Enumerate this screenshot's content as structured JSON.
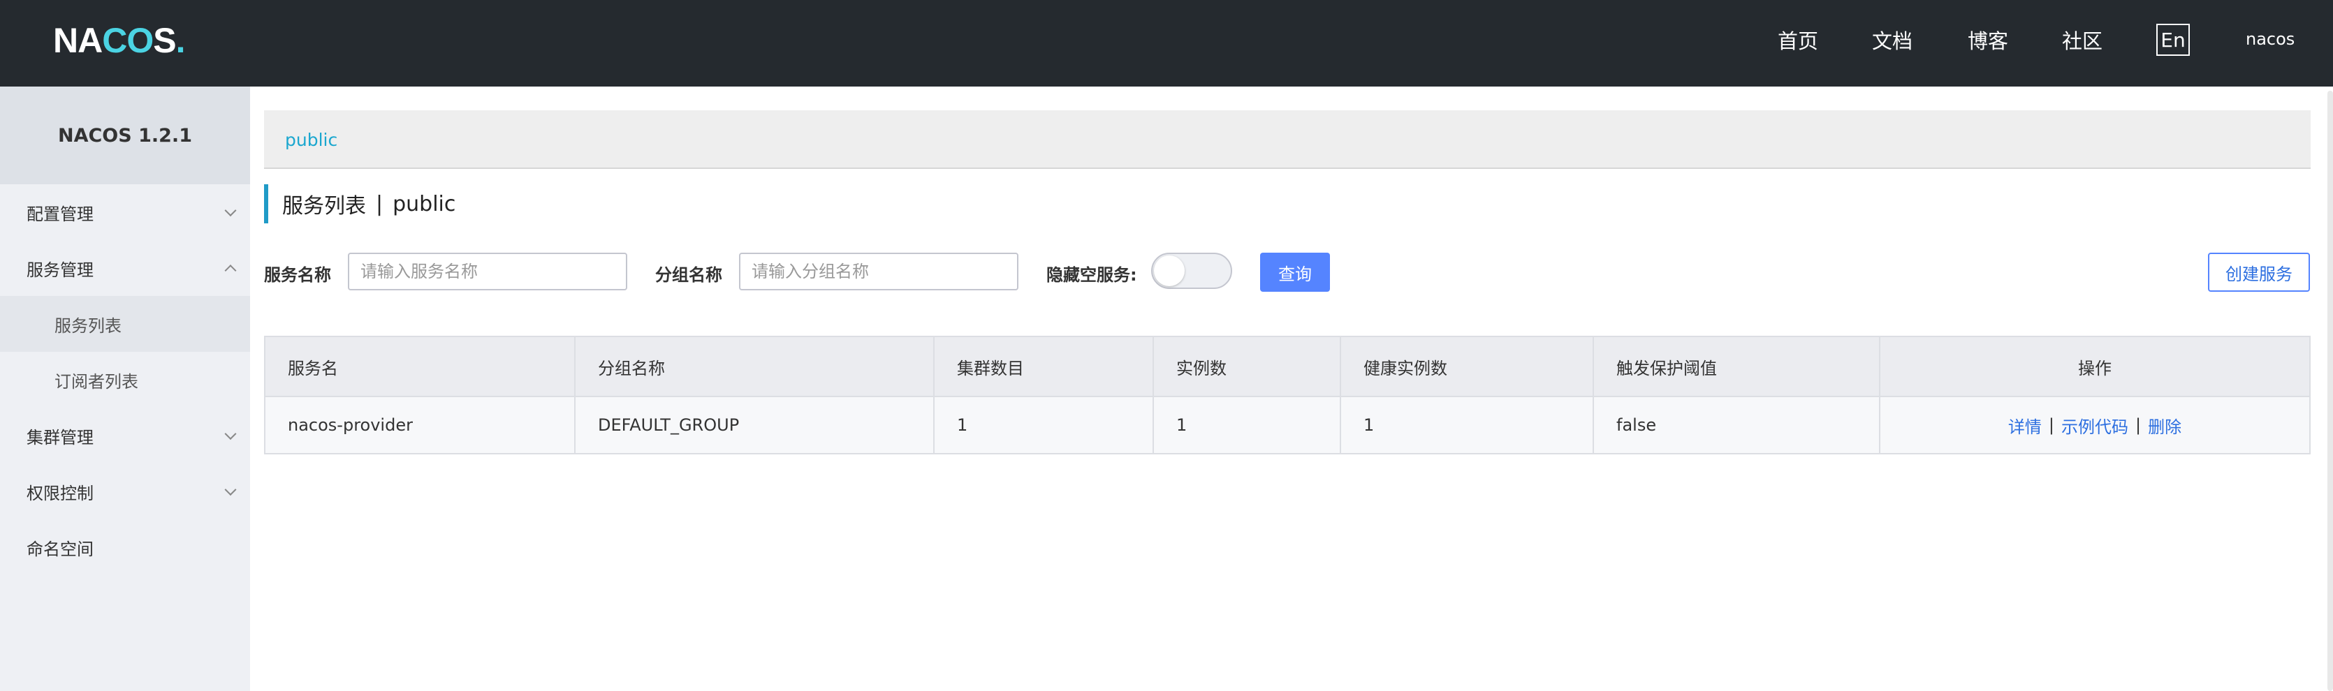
{
  "header": {
    "logo": "NACOS.",
    "nav": [
      "首页",
      "文档",
      "博客",
      "社区"
    ],
    "lang_button": "En",
    "user": "nacos"
  },
  "sidebar": {
    "title": "NACOS 1.2.1",
    "items": [
      {
        "label": "配置管理",
        "expanded": false
      },
      {
        "label": "服务管理",
        "expanded": true
      },
      {
        "label": "服务列表",
        "sub": true,
        "active": true
      },
      {
        "label": "订阅者列表",
        "sub": true
      },
      {
        "label": "集群管理",
        "expanded": false
      },
      {
        "label": "权限控制",
        "expanded": false
      },
      {
        "label": "命名空间"
      }
    ]
  },
  "main": {
    "breadcrumb": "public",
    "page_title": "服务列表",
    "page_title_sep": "|",
    "page_title_namespace": "public",
    "filters": {
      "service_name_label": "服务名称",
      "service_name_placeholder": "请输入服务名称",
      "group_name_label": "分组名称",
      "group_name_placeholder": "请输入分组名称",
      "hide_empty_label": "隐藏空服务:",
      "hide_empty_on": false,
      "query_button": "查询",
      "create_button": "创建服务"
    },
    "table": {
      "columns": [
        "服务名",
        "分组名称",
        "集群数目",
        "实例数",
        "健康实例数",
        "触发保护阈值",
        "操作"
      ],
      "rows": [
        {
          "service": "nacos-provider",
          "group": "DEFAULT_GROUP",
          "clusters": "1",
          "instances": "1",
          "healthy": "1",
          "threshold": "false",
          "actions": [
            "详情",
            "示例代码",
            "删除"
          ]
        }
      ],
      "action_separator": "|"
    }
  },
  "colors": {
    "header_bg": "#252a2f",
    "accent": "#5584ff",
    "link": "#2d6fe0",
    "breadcrumb": "#1ba7cf"
  }
}
